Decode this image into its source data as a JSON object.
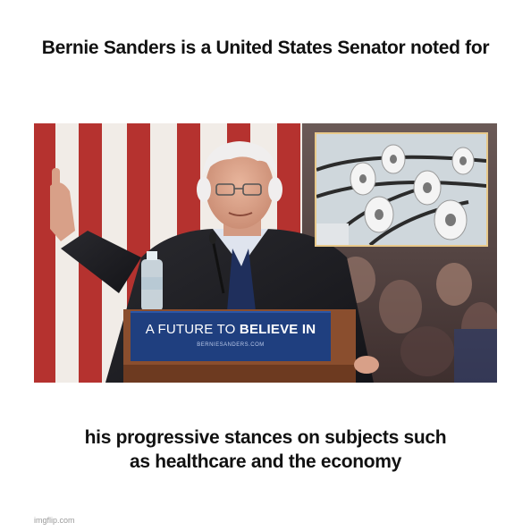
{
  "meme": {
    "top_caption": "Bernie Sanders is a United States Senator noted for",
    "bottom_caption_line1": "his progressive stances on subjects such",
    "bottom_caption_line2": "as healthcare and the economy"
  },
  "podium_sign": {
    "text_regular": "A FUTURE TO ",
    "text_bold": "BELIEVE IN",
    "subtext": "BERNIESANDERS.COM"
  },
  "watermark": "imgflip.com",
  "colors": {
    "flag_red": "#b5322f",
    "flag_white": "#f1ece7",
    "sign_blue": "#1f3f7f",
    "inset_frame": "#e8c98a",
    "podium_wood": "#8a4e2e"
  }
}
